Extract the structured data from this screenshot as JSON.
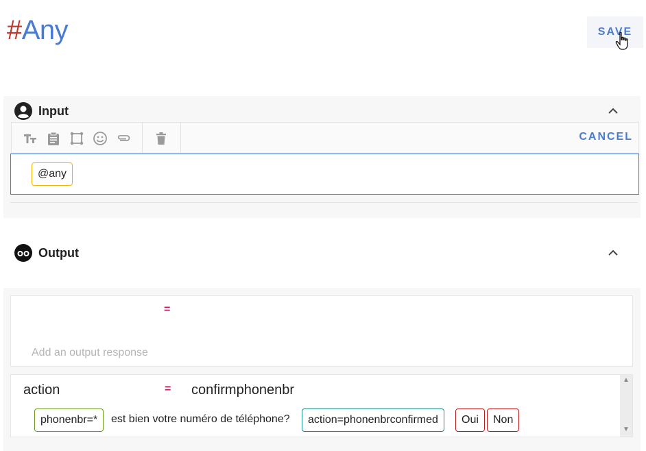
{
  "header": {
    "hash": "#",
    "name": "Any",
    "save_label": "SAVE"
  },
  "input": {
    "title": "Input",
    "toolbar": {
      "icons": [
        "text-format-icon",
        "clipboard-icon",
        "entity-select-icon",
        "emoji-icon",
        "attachment-icon",
        "delete-icon"
      ],
      "cancel_label": "CANCEL"
    },
    "chip": "@any"
  },
  "output": {
    "title": "Output",
    "response1": {
      "equals": "=",
      "placeholder": "Add an output response"
    },
    "response2": {
      "key": "action",
      "equals": "=",
      "value": "confirmphonenbr",
      "tokens": [
        {
          "text": "phonenbr=*",
          "type": "chip",
          "color": "#6a9a1f"
        },
        {
          "text": "est bien votre numéro de téléphone?",
          "type": "text"
        },
        {
          "text": "action=phonenbrconfirmed",
          "type": "chip",
          "color": "#1f8a8a"
        },
        {
          "text": "Oui",
          "type": "chip",
          "color": "#b71c1c"
        },
        {
          "text": "Non",
          "type": "chip",
          "color": "#b71c1c"
        }
      ]
    }
  },
  "colors": {
    "accent": "#4a7bd0",
    "hash": "#c0392b",
    "equals": "#c2185b",
    "input_chip_border": "#f0b400"
  }
}
